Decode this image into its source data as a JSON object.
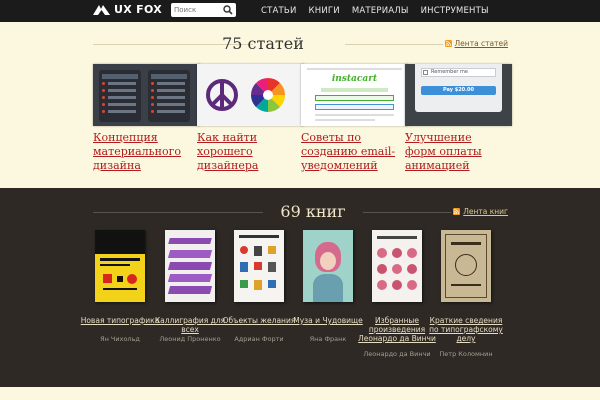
{
  "header": {
    "logo_text": "UX FOX",
    "search_placeholder": "Поиск",
    "nav": [
      "СТАТЬИ",
      "КНИГИ",
      "МАТЕРИАЛЫ",
      "ИНСТРУМЕНТЫ"
    ]
  },
  "articles": {
    "heading": "75 статей",
    "feed_label": "Лента статей",
    "items": [
      {
        "title": "Концепция материального дизайна"
      },
      {
        "title": "Как найти хорошего дизайнера"
      },
      {
        "title": "Советы по созданию email-уведомлений"
      },
      {
        "title": "Улучшение форм оплаты анимацией"
      }
    ],
    "thumb_texts": {
      "instacart": "instacart",
      "remember": "Remember me",
      "pay": "Pay $20.00"
    }
  },
  "books": {
    "heading": "69 книг",
    "feed_label": "Лента книг",
    "items": [
      {
        "title": "Новая типографика",
        "author": "Ян Чихольд"
      },
      {
        "title": "Каллиграфия для всех",
        "author": "Леонид Проненко"
      },
      {
        "title": "Объекты желания",
        "author": "Адриан Форти"
      },
      {
        "title": "Муза и Чудовище",
        "author": "Яна Франк"
      },
      {
        "title": "Избранные произведения Леонардо да Винчи",
        "author": "Леонардо да Винчи"
      },
      {
        "title": "Краткие сведения по типографскому делу",
        "author": "Петр Коломнин"
      }
    ]
  },
  "colors": {
    "link_red": "#b21c1c",
    "articles_bg": "#fcf8e0",
    "books_bg": "#2e2925",
    "topbar_bg": "#1b1b1b"
  },
  "icons": [
    "fox-logo-icon",
    "search-icon",
    "rss-icon",
    "peace-icon",
    "color-wheel-icon"
  ]
}
